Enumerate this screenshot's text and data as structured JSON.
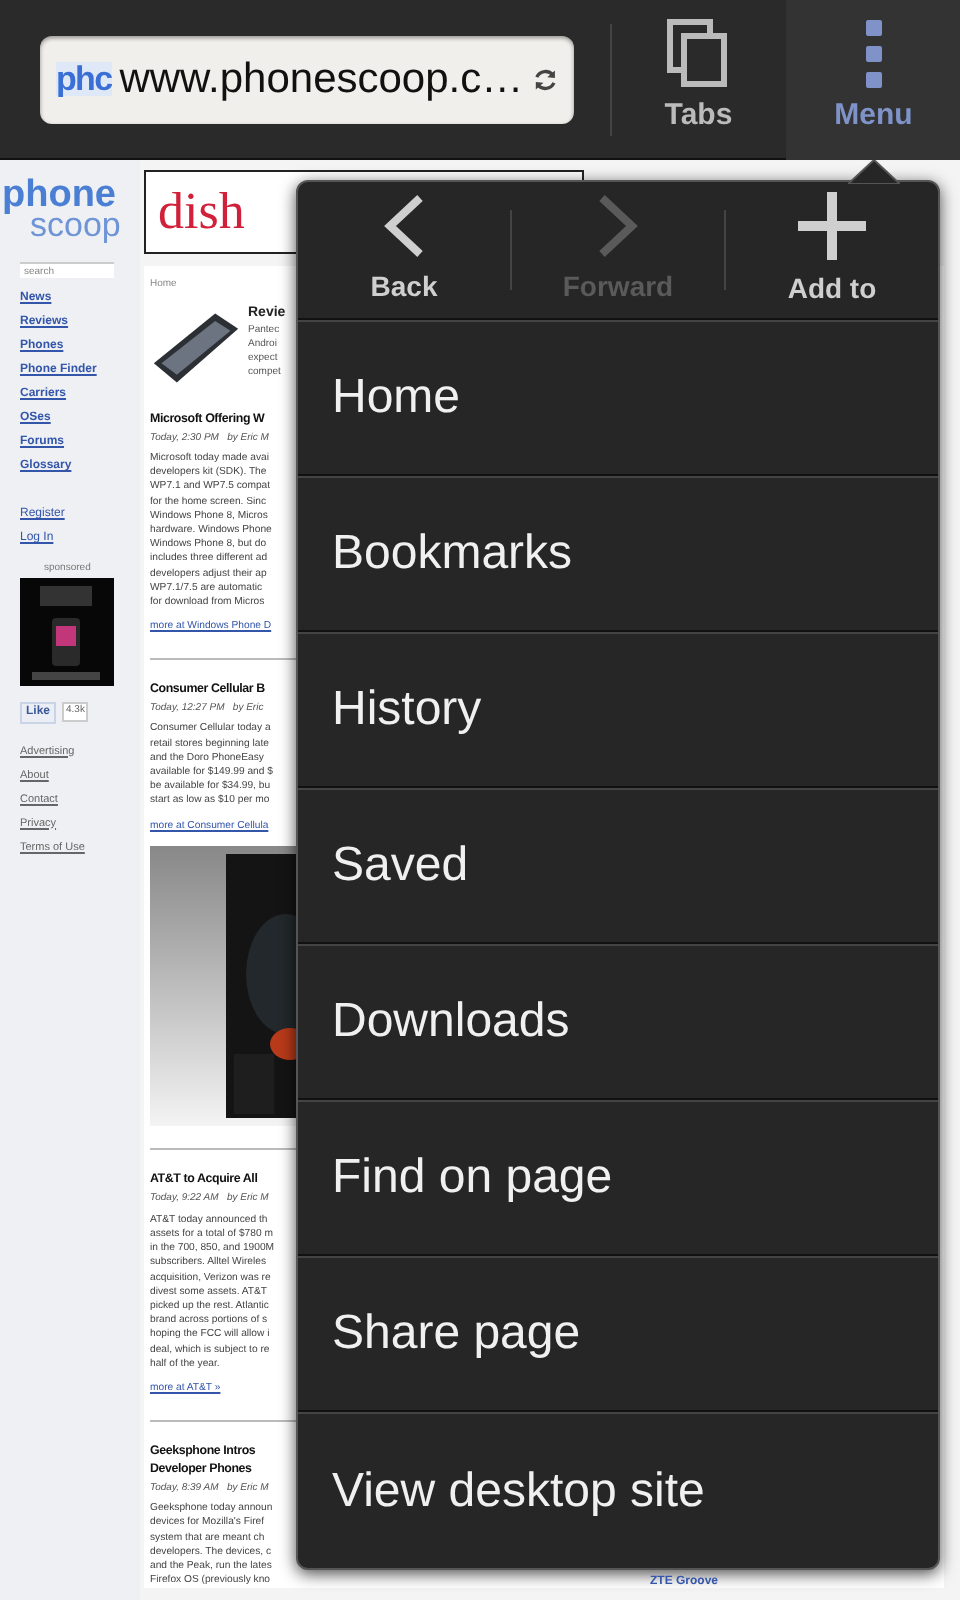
{
  "toolbar": {
    "favicon": "phc",
    "url": "www.phonescoop.c…",
    "buttons": [
      {
        "label": "Tabs",
        "kind": "tabs",
        "selected": false
      },
      {
        "label": "Menu",
        "kind": "menu",
        "selected": true
      }
    ]
  },
  "page": {
    "logo": [
      "phone",
      "scoop"
    ],
    "search_placeholder": "search",
    "nav": [
      "News",
      "Reviews",
      "Phones",
      "Phone Finder",
      "Carriers",
      "OSes",
      "Forums",
      "Glossary"
    ],
    "account": [
      "Register",
      "Log In"
    ],
    "sponsored": "sponsored",
    "like": {
      "label": "Like",
      "count": "4.3k"
    },
    "footer": [
      "Advertising",
      "About",
      "Contact",
      "Privacy",
      "Terms of Use"
    ],
    "ad": "dish",
    "breadcrumb": "Home",
    "review": {
      "title": "Revie",
      "lines": [
        "Pantec",
        "Androi",
        "expect",
        "compet"
      ]
    },
    "articles": [
      {
        "title": [
          "Microsoft Offering W"
        ],
        "byline": "Today, 2:30 PM   by Eric M",
        "lines": [
          "Microsoft today made avai",
          "developers kit (SDK). The",
          "WP7.1 and WP7.5 compat",
          "for the home screen. Sinc",
          "Windows Phone 8, Micros",
          "hardware. Windows Phone",
          "Windows Phone 8, but do",
          "includes three different ad",
          "developers adjust their ap",
          "WP7.1/7.5 are automatic",
          "for download from Micros"
        ],
        "more": "more at Windows Phone D",
        "picture": false
      },
      {
        "title": [
          "Consumer Cellular B"
        ],
        "byline": "Today, 12:27 PM   by Eric",
        "lines": [
          "Consumer Cellular today a",
          "retail stores beginning late",
          "and the Doro PhoneEasy",
          "available for $149.99 and $",
          "be available for $34.99, bu",
          "start as low as $10 per mo"
        ],
        "more": "more at Consumer Cellula",
        "picture": true
      },
      {
        "title": [
          "AT&T to Acquire All"
        ],
        "byline": "Today, 9:22 AM   by Eric M",
        "lines": [
          "AT&T today announced th",
          "assets for a total of $780 m",
          "in the 700, 850, and 1900M",
          "subscribers. Alltel Wireles",
          "acquisition, Verizon was re",
          "divest some assets. AT&T",
          "picked up the rest. Atlantic",
          "brand across portions of s",
          "hoping the FCC will allow i",
          "deal, which is subject to re",
          "half of the year."
        ],
        "more": "more at AT&T »",
        "picture": false
      },
      {
        "title": [
          "Geeksphone Intros",
          "Developer Phones"
        ],
        "byline": "Today, 8:39 AM   by Eric M",
        "lines": [
          "Geeksphone today announ",
          "devices for Mozilla's Firef",
          "system that are meant ch",
          "developers. The devices, c",
          "and the Peak, run the lates",
          "Firefox OS (previously kno"
        ],
        "picture": false
      }
    ],
    "bottom_caption": "ZTE Groove"
  },
  "menu": {
    "actions": [
      {
        "label": "Back",
        "kind": "back",
        "disabled": false
      },
      {
        "label": "Forward",
        "kind": "forward",
        "disabled": true
      },
      {
        "label": "Add to",
        "kind": "add",
        "disabled": false
      }
    ],
    "items": [
      "Home",
      "Bookmarks",
      "History",
      "Saved",
      "Downloads",
      "Find on page",
      "Share page",
      "View desktop site"
    ]
  }
}
